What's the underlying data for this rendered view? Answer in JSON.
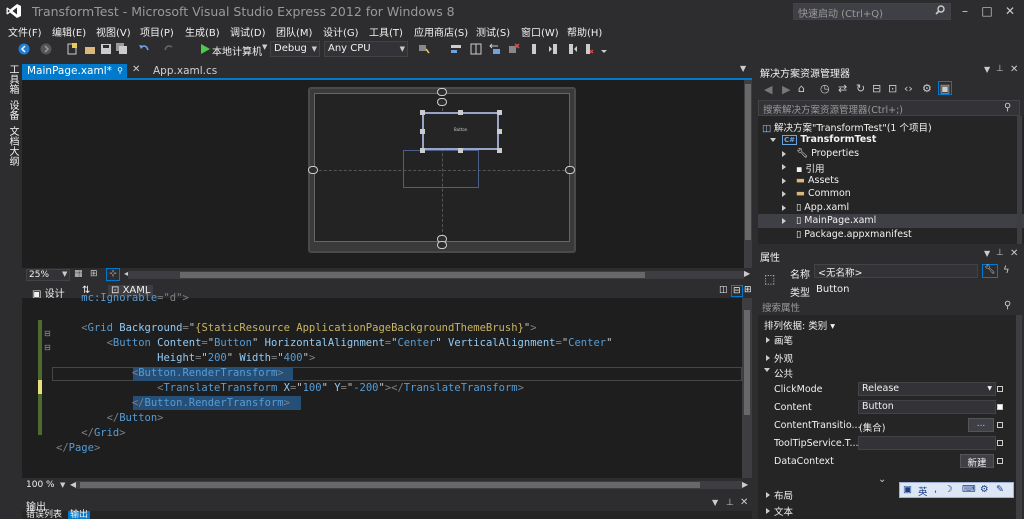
{
  "window": {
    "title": "TransformTest - Microsoft Visual Studio Express 2012 for Windows 8",
    "quick_launch_placeholder": "快速启动 (Ctrl+Q)"
  },
  "menu": [
    "文件(F)",
    "编辑(E)",
    "视图(V)",
    "项目(P)",
    "生成(B)",
    "调试(D)",
    "团队(M)",
    "设计(G)",
    "工具(T)",
    "应用商店(S)",
    "测试(S)",
    "窗口(W)",
    "帮助(H)"
  ],
  "toolbar": {
    "run_target": "本地计算机",
    "config": "Debug",
    "platform": "Any CPU"
  },
  "left_rail": [
    "工具箱",
    "设备",
    "文档大纲"
  ],
  "doc_tabs": [
    "MainPage.xaml*",
    "App.xaml.cs"
  ],
  "designer": {
    "zoom": "25%",
    "button_text": "Button"
  },
  "split": {
    "design_tab": "设计",
    "xaml_tab": "XAML"
  },
  "editor": {
    "zoom": "100 %",
    "lines": [
      {
        "indent": "    ",
        "segs": [
          [
            "t",
            "mc:Ignorable"
          ],
          [
            "p",
            "=\"d\">"
          ]
        ]
      },
      {
        "indent": "",
        "segs": []
      },
      {
        "indent": "    ",
        "segs": [
          [
            "p",
            "<"
          ],
          [
            "t",
            "Grid"
          ],
          [
            "a",
            " Background"
          ],
          [
            "p",
            "="
          ],
          [
            "q",
            "\""
          ],
          [
            "v",
            "{StaticResource ApplicationPageBackgroundThemeBrush}"
          ],
          [
            "q",
            "\""
          ],
          [
            "p",
            ">"
          ]
        ]
      },
      {
        "indent": "        ",
        "segs": [
          [
            "p",
            "<"
          ],
          [
            "t",
            "Button"
          ],
          [
            "a",
            " Content"
          ],
          [
            "p",
            "="
          ],
          [
            "q",
            "\""
          ],
          [
            "t",
            "Button"
          ],
          [
            "q",
            "\""
          ],
          [
            "a",
            " HorizontalAlignment"
          ],
          [
            "p",
            "="
          ],
          [
            "q",
            "\""
          ],
          [
            "t",
            "Center"
          ],
          [
            "q",
            "\""
          ],
          [
            "a",
            " VerticalAlignment"
          ],
          [
            "p",
            "="
          ],
          [
            "q",
            "\""
          ],
          [
            "t",
            "Center"
          ],
          [
            "q",
            "\""
          ]
        ]
      },
      {
        "indent": "                ",
        "segs": [
          [
            "a",
            "Height"
          ],
          [
            "p",
            "="
          ],
          [
            "q",
            "\""
          ],
          [
            "t",
            "200"
          ],
          [
            "q",
            "\""
          ],
          [
            "a",
            " Width"
          ],
          [
            "p",
            "="
          ],
          [
            "q",
            "\""
          ],
          [
            "t",
            "400"
          ],
          [
            "q",
            "\""
          ],
          [
            "p",
            ">"
          ]
        ]
      },
      {
        "indent": "            ",
        "segs": [
          [
            "p",
            "<"
          ],
          [
            "t",
            "Button.RenderTransform"
          ],
          [
            "p",
            ">"
          ]
        ]
      },
      {
        "indent": "                ",
        "segs": [
          [
            "p",
            "<"
          ],
          [
            "t",
            "TranslateTransform"
          ],
          [
            "a",
            " X"
          ],
          [
            "p",
            "="
          ],
          [
            "q",
            "\""
          ],
          [
            "t",
            "100"
          ],
          [
            "q",
            "\""
          ],
          [
            "a",
            " Y"
          ],
          [
            "p",
            "="
          ],
          [
            "q",
            "\""
          ],
          [
            "t",
            "-200"
          ],
          [
            "q",
            "\""
          ],
          [
            "p",
            "></"
          ],
          [
            "t",
            "TranslateTransform"
          ],
          [
            "p",
            ">"
          ]
        ]
      },
      {
        "indent": "            ",
        "segs": [
          [
            "p",
            "</"
          ],
          [
            "t",
            "Button.RenderTransform"
          ],
          [
            "p",
            ">"
          ]
        ]
      },
      {
        "indent": "        ",
        "segs": [
          [
            "p",
            "</"
          ],
          [
            "t",
            "Button"
          ],
          [
            "p",
            ">"
          ]
        ]
      },
      {
        "indent": "    ",
        "segs": [
          [
            "p",
            "</"
          ],
          [
            "t",
            "Grid"
          ],
          [
            "p",
            ">"
          ]
        ]
      },
      {
        "indent": "",
        "segs": [
          [
            "p",
            "</"
          ],
          [
            "t",
            "Page"
          ],
          [
            "p",
            ">"
          ]
        ]
      }
    ]
  },
  "output": {
    "title": "输出",
    "tabs": [
      "错误列表",
      "输出"
    ]
  },
  "solution_explorer": {
    "title": "解决方案资源管理器",
    "search_placeholder": "搜索解决方案资源管理器(Ctrl+;)",
    "solution": "解决方案\"TransformTest\"(1 个项目)",
    "project": "TransformTest",
    "items": [
      "Properties",
      "引用",
      "Assets",
      "Common",
      "App.xaml",
      "MainPage.xaml",
      "Package.appxmanifest"
    ]
  },
  "properties": {
    "title": "属性",
    "name_label": "名称",
    "name_value": "<无名称>",
    "type_label": "类型",
    "type_value": "Button",
    "search_placeholder": "搜索属性",
    "sort_label": "排列依据: 类别",
    "categories": [
      "画笔",
      "外观",
      "公共",
      "布局",
      "文本"
    ],
    "rows": [
      {
        "name": "ClickMode",
        "value": "Release"
      },
      {
        "name": "Content",
        "value": "Button"
      },
      {
        "name": "ContentTransitio...",
        "value": "(集合)"
      },
      {
        "name": "ToolTipService.T...",
        "value": ""
      },
      {
        "name": "DataContext",
        "value": "新建"
      }
    ]
  },
  "ime": {
    "lang": "英"
  },
  "colors": {
    "accent": "#007acc",
    "background": "#2d2d30",
    "editor_bg": "#1e1e1e"
  }
}
